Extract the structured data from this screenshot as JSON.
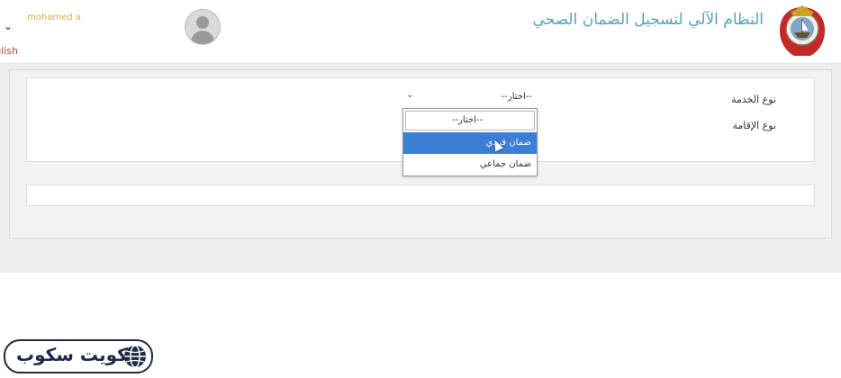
{
  "header": {
    "app_title": "النظام الآلي لتسجيل الضمان الصحي",
    "username": "mohamed a",
    "language_link": "English"
  },
  "form": {
    "service_type_label": "نوع الخدمة",
    "residence_type_label": "نوع الإقامة",
    "service_select": {
      "selected": "--اختار--",
      "options": [
        "--اختار--",
        "ضمان فردي",
        "ضمان جماعي"
      ],
      "highlighted_index": 1
    }
  },
  "watermark": {
    "text": "كويت سكوب"
  },
  "colors": {
    "title": "#55a3b4",
    "username": "#e0a84a",
    "language_link": "#b5483b",
    "highlight": "#3a7fd5",
    "logo_navy": "#1f2a48"
  }
}
